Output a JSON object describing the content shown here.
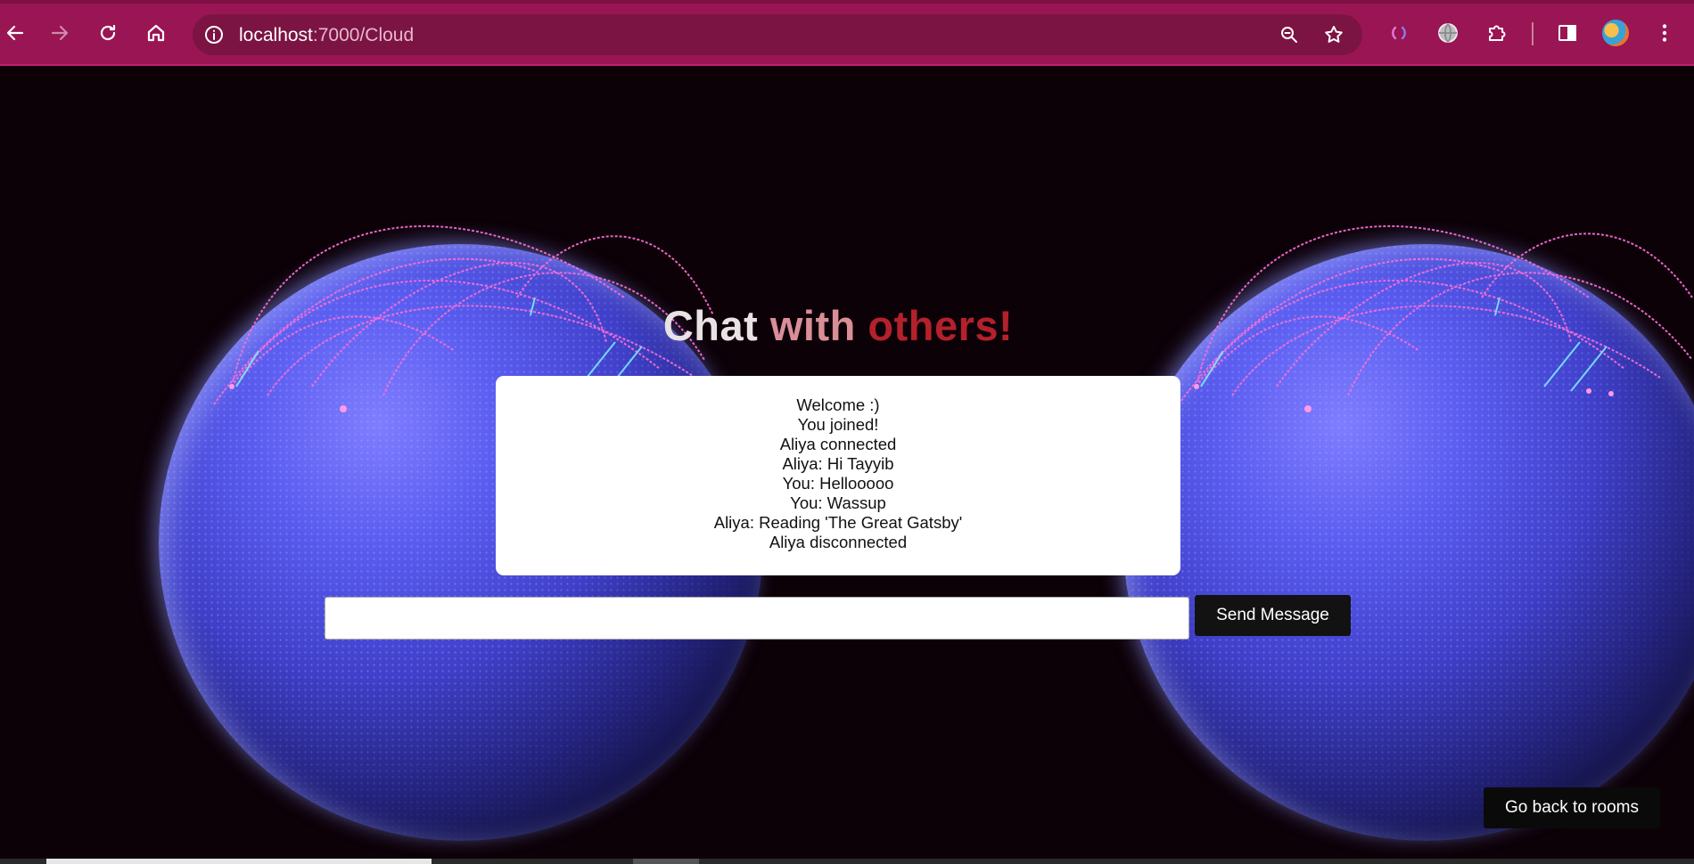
{
  "browser": {
    "url_host": "localhost",
    "url_path": ":7000/Cloud",
    "icons": {
      "back": "arrow-left-icon",
      "forward": "arrow-right-icon",
      "reload": "reload-icon",
      "home": "home-icon",
      "site_info": "info-icon",
      "zoom": "zoom-icon",
      "bookmark": "star-icon",
      "extension1": "loading-extension-icon",
      "extension2": "globe-extension-icon",
      "extensions": "puzzle-icon",
      "side_panel": "side-panel-icon",
      "profile": "avatar",
      "menu": "kebab-menu-icon"
    },
    "colors": {
      "frame": "#9a1553",
      "omnibox": "#7b1443"
    }
  },
  "page": {
    "title": {
      "word1": "Chat",
      "word2": "with",
      "word3": "others!"
    },
    "messages": [
      "Welcome :)",
      "You joined!",
      "Aliya connected",
      "Aliya: Hi Tayyib",
      "You: Hellooooo",
      "You: Wassup",
      "Aliya: Reading 'The Great Gatsby'",
      "Aliya disconnected"
    ],
    "message_input": {
      "value": "",
      "placeholder": ""
    },
    "send_button_label": "Send Message",
    "back_button_label": "Go back to rooms",
    "colors": {
      "background": "#0d0108",
      "title_word1": "#e9e2e4",
      "title_word2": "#d98f98",
      "title_word3": "#b4212b"
    }
  }
}
